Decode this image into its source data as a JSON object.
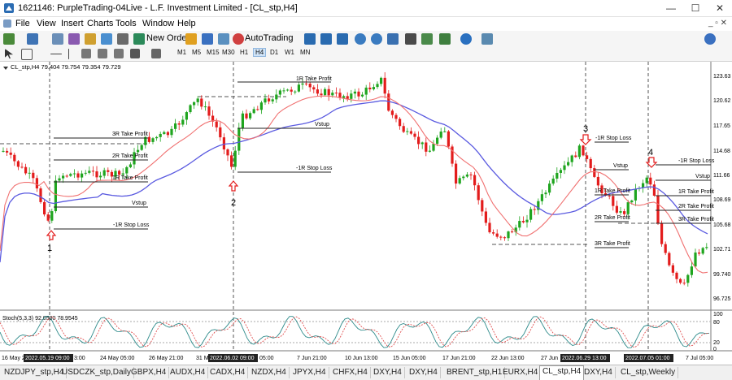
{
  "window": {
    "title": "1621146: PurpleTrading-04Live - L.F. Investment Limited - [CL_stp,H4]",
    "controls": [
      "—",
      "☐",
      "✕"
    ]
  },
  "menu": {
    "items": [
      "File",
      "View",
      "Insert",
      "Charts",
      "Tools",
      "Window",
      "Help"
    ],
    "right": "_ ▫ ✕"
  },
  "toolbar": {
    "new_order": "New Order",
    "autotrading": "AutoTrading",
    "timeframes": [
      "M1",
      "M5",
      "M15",
      "M30",
      "H1",
      "H4",
      "D1",
      "W1",
      "MN"
    ],
    "active_timeframe": "H4"
  },
  "chart": {
    "info": "CL_stp,H4  79.404 79.754 79.354 79.729",
    "price_axis": [
      "123.63",
      "120.62",
      "117.65",
      "114.68",
      "111.66",
      "108.69",
      "105.68",
      "102.71",
      "99.740",
      "96.725"
    ],
    "stoch_label": "Stoch(5,3,3) 92.0530 78.9545",
    "stoch_axis": [
      "100",
      "80",
      "20",
      "0"
    ],
    "time_axis": [
      "16 May 2",
      "24 May 05:00",
      "26 May 21:00",
      "31 M",
      "7 Jun 21:00",
      "10 Jun 13:00",
      "15 Jun 05:00",
      "17 Jun 21:00",
      "22 Jun 13:00",
      "27 Jun",
      "7 Jul 05:00"
    ],
    "time_highlights": [
      "2022.05.19 09:00",
      "2022.06.02 09:00",
      "2022.06.29 13:00",
      "2022.07.05 01:00"
    ],
    "time_partial": "3:00",
    "time_partial2": "05:00",
    "setup_numbers": [
      "1",
      "2",
      "3",
      "4"
    ],
    "annotations": {
      "s1_3r": "3R Take Profit",
      "s1_2r": "2R Take Profit",
      "s1_1r": "1R Take Profit",
      "s1_vstup": "Vstup",
      "s1_sl": "-1R Stop Loss",
      "s2_1r": "1R Take Profit",
      "s2_vstup": "Vstup",
      "s2_sl": "-1R Stop Loss",
      "s3_sl": "-1R Stop Loss",
      "s3_vstup": "Vstup",
      "s3_1r": "1R Take Profit",
      "s3_2r": "2R Take Profit",
      "s3_3r": "3R Take Profit",
      "s4_sl": "-1R Stop Loss",
      "s4_vstup": "Vstup",
      "s4_1r": "1R Take Profit",
      "s4_2r": "2R Take Profit",
      "s4_3r": "3R Take Profit"
    },
    "colors": {
      "bull": "#1fa51f",
      "bear": "#e31c1c",
      "ma_fast": "#f07070",
      "ma_slow": "#5a5ae0",
      "stoch_main": "#2e8b8b",
      "stoch_signal": "#e05050"
    }
  },
  "tabs": {
    "items": [
      "NZDJPY_stp,H4",
      "USDCZK_stp,Daily",
      "GBPX,H4",
      "AUDX,H4",
      "CADX,H4",
      "NZDX,H4",
      "JPYX,H4",
      "CHFX,H4",
      "DXY,H4",
      "DXY,H4",
      "BRENT_stp,H1",
      "EURX,H4",
      "CL_stp,H4",
      "DXY,H4",
      "CL_stp,Weekly"
    ],
    "active": "CL_stp,H4"
  }
}
